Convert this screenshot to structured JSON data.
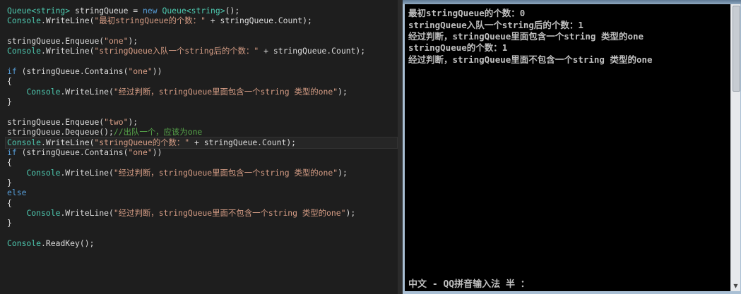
{
  "editor": {
    "lines": [
      [
        {
          "t": "Queue<string>",
          "c": "type"
        },
        {
          "t": " stringQueue = ",
          "c": "plain"
        },
        {
          "t": "new",
          "c": "kw"
        },
        {
          "t": " ",
          "c": "plain"
        },
        {
          "t": "Queue<string>",
          "c": "type"
        },
        {
          "t": "();",
          "c": "plain"
        }
      ],
      [
        {
          "t": "Console",
          "c": "type"
        },
        {
          "t": ".WriteLine(",
          "c": "plain"
        },
        {
          "t": "\"最初stringQueue的个数：\"",
          "c": "str"
        },
        {
          "t": " + stringQueue.Count);",
          "c": "plain"
        }
      ],
      [],
      [
        {
          "t": "stringQueue.Enqueue(",
          "c": "plain"
        },
        {
          "t": "\"one\"",
          "c": "str"
        },
        {
          "t": ");",
          "c": "plain"
        }
      ],
      [
        {
          "t": "Console",
          "c": "type"
        },
        {
          "t": ".WriteLine(",
          "c": "plain"
        },
        {
          "t": "\"stringQueue入队一个string后的个数：\"",
          "c": "str"
        },
        {
          "t": " + stringQueue.Count);",
          "c": "plain"
        }
      ],
      [],
      [
        {
          "t": "if",
          "c": "kw"
        },
        {
          "t": " (stringQueue.Contains(",
          "c": "plain"
        },
        {
          "t": "\"one\"",
          "c": "str"
        },
        {
          "t": "))",
          "c": "plain"
        }
      ],
      [
        {
          "t": "{",
          "c": "plain"
        }
      ],
      [
        {
          "t": "    ",
          "c": "plain"
        },
        {
          "t": "Console",
          "c": "type"
        },
        {
          "t": ".WriteLine(",
          "c": "plain"
        },
        {
          "t": "\"经过判断，stringQueue里面包含一个string 类型的one\"",
          "c": "str"
        },
        {
          "t": ");",
          "c": "plain"
        }
      ],
      [
        {
          "t": "}",
          "c": "plain"
        }
      ],
      [],
      [
        {
          "t": "stringQueue.Enqueue(",
          "c": "plain"
        },
        {
          "t": "\"two\"",
          "c": "str"
        },
        {
          "t": ");",
          "c": "plain"
        }
      ],
      [
        {
          "t": "stringQueue.Dequeue();",
          "c": "plain"
        },
        {
          "t": "//出队一个，应该为one",
          "c": "cmt"
        }
      ],
      [
        {
          "t": "Console",
          "c": "type"
        },
        {
          "t": ".WriteLine(",
          "c": "plain"
        },
        {
          "t": "\"stringQueue的个数：\"",
          "c": "str"
        },
        {
          "t": " + stringQueue.Count);",
          "c": "plain"
        }
      ],
      [
        {
          "t": "if",
          "c": "kw"
        },
        {
          "t": " (stringQueue.Contains(",
          "c": "plain"
        },
        {
          "t": "\"one\"",
          "c": "str"
        },
        {
          "t": "))",
          "c": "plain"
        }
      ],
      [
        {
          "t": "{",
          "c": "plain"
        }
      ],
      [
        {
          "t": "    ",
          "c": "plain"
        },
        {
          "t": "Console",
          "c": "type"
        },
        {
          "t": ".WriteLine(",
          "c": "plain"
        },
        {
          "t": "\"经过判断，stringQueue里面包含一个string 类型的one\"",
          "c": "str"
        },
        {
          "t": ");",
          "c": "plain"
        }
      ],
      [
        {
          "t": "}",
          "c": "plain"
        }
      ],
      [
        {
          "t": "else",
          "c": "kw"
        }
      ],
      [
        {
          "t": "{",
          "c": "plain"
        }
      ],
      [
        {
          "t": "    ",
          "c": "plain"
        },
        {
          "t": "Console",
          "c": "type"
        },
        {
          "t": ".WriteLine(",
          "c": "plain"
        },
        {
          "t": "\"经过判断，stringQueue里面不包含一个string 类型的one\"",
          "c": "str"
        },
        {
          "t": ");",
          "c": "plain"
        }
      ],
      [
        {
          "t": "}",
          "c": "plain"
        }
      ],
      [],
      [
        {
          "t": "Console",
          "c": "type"
        },
        {
          "t": ".ReadKey();",
          "c": "plain"
        }
      ]
    ]
  },
  "console": {
    "lines": [
      "最初stringQueue的个数：0",
      "stringQueue入队一个string后的个数：1",
      "经过判断，stringQueue里面包含一个string 类型的one",
      "stringQueue的个数：1",
      "经过判断，stringQueue里面不包含一个string 类型的one"
    ],
    "ime_status": "中文 - QQ拼音输入法 半 ："
  },
  "colors": {
    "editor_bg": "#1e1e1e",
    "keyword": "#569cd6",
    "type": "#4ec9b0",
    "string": "#d69d85",
    "comment": "#57a64a",
    "console_bg": "#000000",
    "console_text": "#c0c0c0"
  }
}
